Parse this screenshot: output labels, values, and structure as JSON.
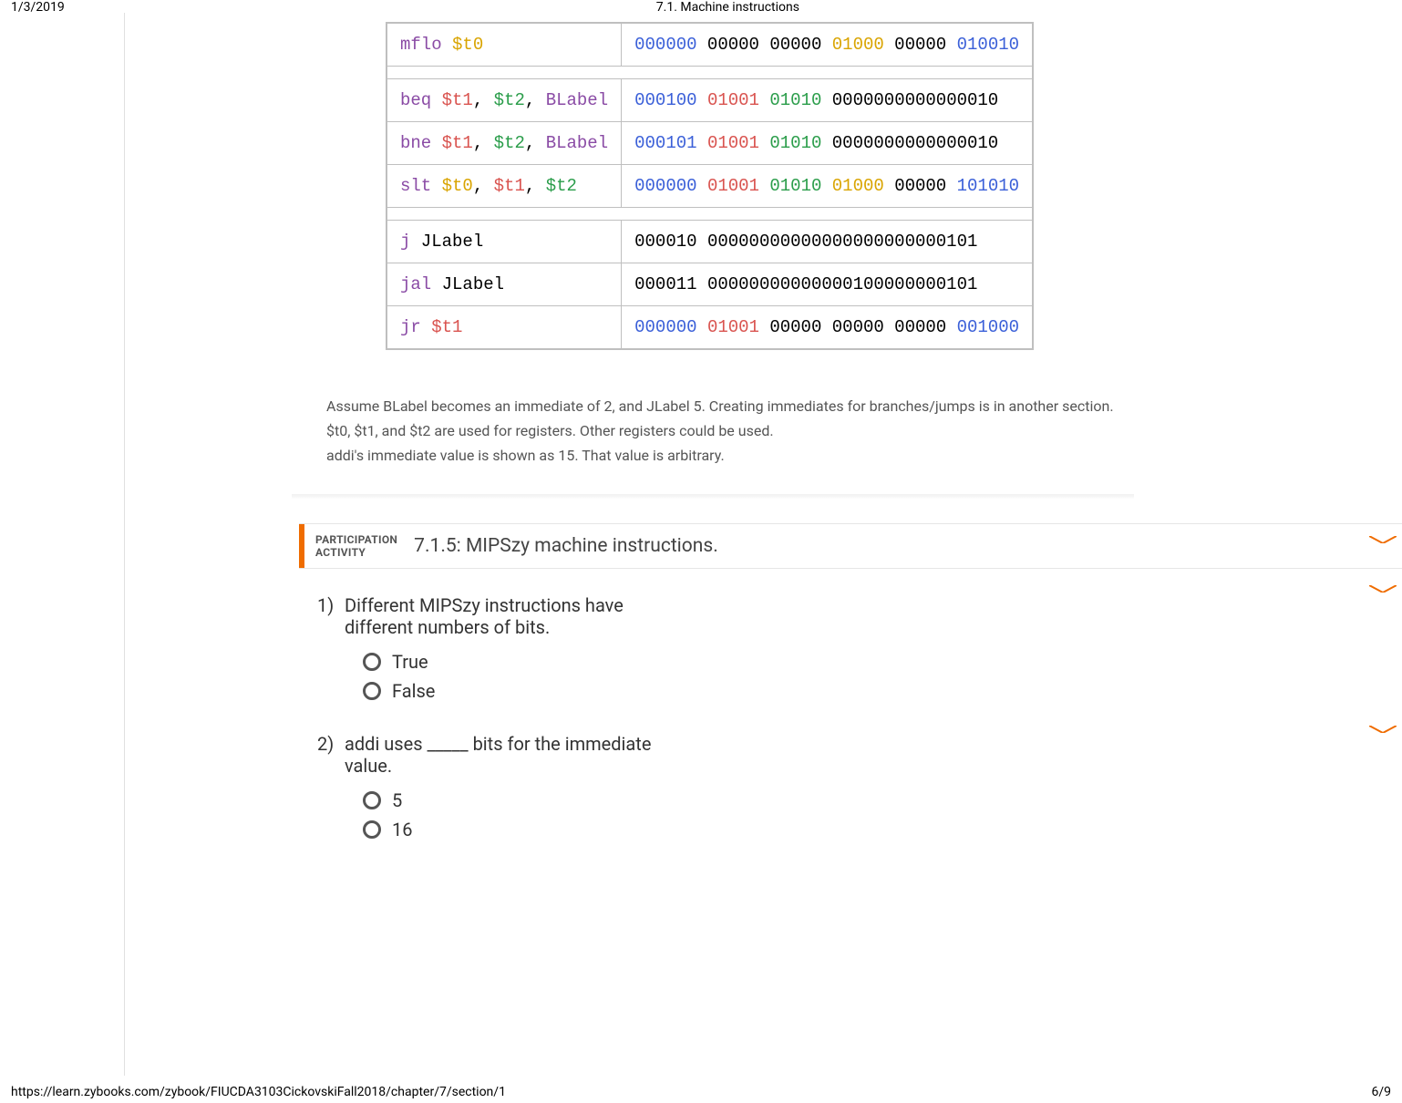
{
  "print": {
    "date": "1/3/2019",
    "title": "7.1. Machine instructions",
    "url": "https://learn.zybooks.com/zybook/FIUCDA3103CickovskiFall2018/chapter/7/section/1",
    "page": "6/9"
  },
  "table": {
    "rows": [
      {
        "asm": [
          [
            "mflo",
            "purple"
          ],
          [
            " ",
            ""
          ],
          [
            "$t0",
            "orange"
          ]
        ],
        "bin": [
          [
            "000000",
            "blue"
          ],
          [
            " 00000 00000 ",
            ""
          ],
          [
            "01000",
            "orange"
          ],
          [
            " 00000 ",
            ""
          ],
          [
            "010010",
            "blue"
          ]
        ]
      },
      {
        "spacer": true
      },
      {
        "asm": [
          [
            "beq",
            "purple"
          ],
          [
            " ",
            ""
          ],
          [
            "$t1",
            "red"
          ],
          [
            ", ",
            ""
          ],
          [
            "$t2",
            "green"
          ],
          [
            ", ",
            ""
          ],
          [
            "BLabel",
            "purple"
          ]
        ],
        "bin": [
          [
            "000100",
            "blue"
          ],
          [
            " ",
            ""
          ],
          [
            "01001",
            "red"
          ],
          [
            " ",
            ""
          ],
          [
            "01010",
            "green"
          ],
          [
            "  ",
            ""
          ],
          [
            "0000000000000010",
            ""
          ]
        ]
      },
      {
        "asm": [
          [
            "bne",
            "purple"
          ],
          [
            " ",
            ""
          ],
          [
            "$t1",
            "red"
          ],
          [
            ", ",
            ""
          ],
          [
            "$t2",
            "green"
          ],
          [
            ", ",
            ""
          ],
          [
            "BLabel",
            "purple"
          ]
        ],
        "bin": [
          [
            "000101",
            "blue"
          ],
          [
            " ",
            ""
          ],
          [
            "01001",
            "red"
          ],
          [
            " ",
            ""
          ],
          [
            "01010",
            "green"
          ],
          [
            "  ",
            ""
          ],
          [
            "0000000000000010",
            ""
          ]
        ]
      },
      {
        "asm": [
          [
            "slt",
            "purple"
          ],
          [
            " ",
            ""
          ],
          [
            "$t0",
            "orange"
          ],
          [
            ", ",
            ""
          ],
          [
            "$t1",
            "red"
          ],
          [
            ", ",
            ""
          ],
          [
            "$t2",
            "green"
          ]
        ],
        "bin": [
          [
            "000000",
            "blue"
          ],
          [
            " ",
            ""
          ],
          [
            "01001",
            "red"
          ],
          [
            " ",
            ""
          ],
          [
            "01010",
            "green"
          ],
          [
            "  ",
            ""
          ],
          [
            "01000",
            "orange"
          ],
          [
            " 00000 ",
            ""
          ],
          [
            "101010",
            "blue"
          ]
        ]
      },
      {
        "spacer": true
      },
      {
        "asm": [
          [
            "j",
            "purple"
          ],
          [
            " JLabel",
            ""
          ]
        ],
        "bin": [
          [
            "000010",
            ""
          ],
          [
            "  ",
            ""
          ],
          [
            "00000000000000000000000101",
            ""
          ]
        ]
      },
      {
        "asm": [
          [
            "jal",
            "purple"
          ],
          [
            " JLabel",
            ""
          ]
        ],
        "bin": [
          [
            "000011",
            ""
          ],
          [
            "  ",
            ""
          ],
          [
            "00000000000000100000000101",
            ""
          ]
        ]
      },
      {
        "asm": [
          [
            "jr",
            "purple"
          ],
          [
            " ",
            ""
          ],
          [
            "$t1",
            "red"
          ]
        ],
        "bin": [
          [
            "000000",
            "blue"
          ],
          [
            " ",
            ""
          ],
          [
            "01001",
            "red"
          ],
          [
            " 00000 00000 00000 ",
            ""
          ],
          [
            "001000",
            "blue"
          ]
        ]
      }
    ]
  },
  "notes": {
    "l1": "Assume BLabel becomes an immediate of 2, and JLabel 5. Creating immediates for branches/jumps is in another section.",
    "l2": "$t0, $t1, and $t2 are used for registers. Other registers could be used.",
    "l3": "addi's immediate value is shown as 15. That value is arbitrary."
  },
  "pa": {
    "tag_line1": "PARTICIPATION",
    "tag_line2": "ACTIVITY",
    "title": "7.1.5: MIPSzy machine instructions.",
    "q1": {
      "num": "1)",
      "text": "Different MIPSzy instructions have different numbers of bits.",
      "opt1": "True",
      "opt2": "False"
    },
    "q2": {
      "num": "2)",
      "text": "addi uses _____ bits for the immediate value.",
      "opt1": "5",
      "opt2": "16"
    }
  }
}
